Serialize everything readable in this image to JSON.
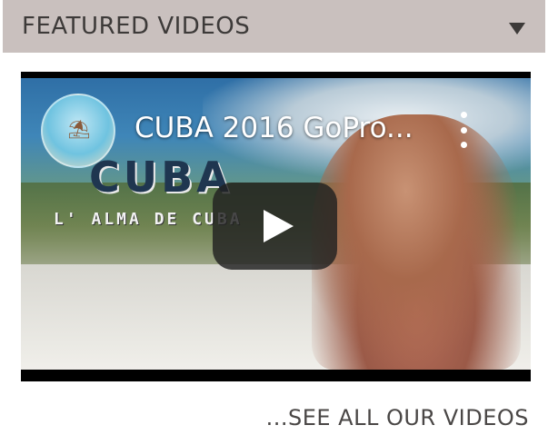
{
  "widget": {
    "header_title": "FEATURED VIDEOS",
    "toggle_icon": "caret-down-icon"
  },
  "video": {
    "title": "CUBA 2016 GoPro...",
    "overlay_title_text": "CUBA",
    "overlay_subtitle_text": "L' ALMA DE CUBA",
    "menu_icon": "vertical-dots-icon",
    "play_icon": "play-icon",
    "channel_avatar_icon": "channel-avatar-icon",
    "player_button_color": "#212121"
  },
  "footer": {
    "see_all_label": "...SEE ALL OUR VIDEOS"
  },
  "colors": {
    "header_bg": "#c9c0be",
    "header_text": "#3d3a39",
    "link_text": "#4a4746"
  }
}
